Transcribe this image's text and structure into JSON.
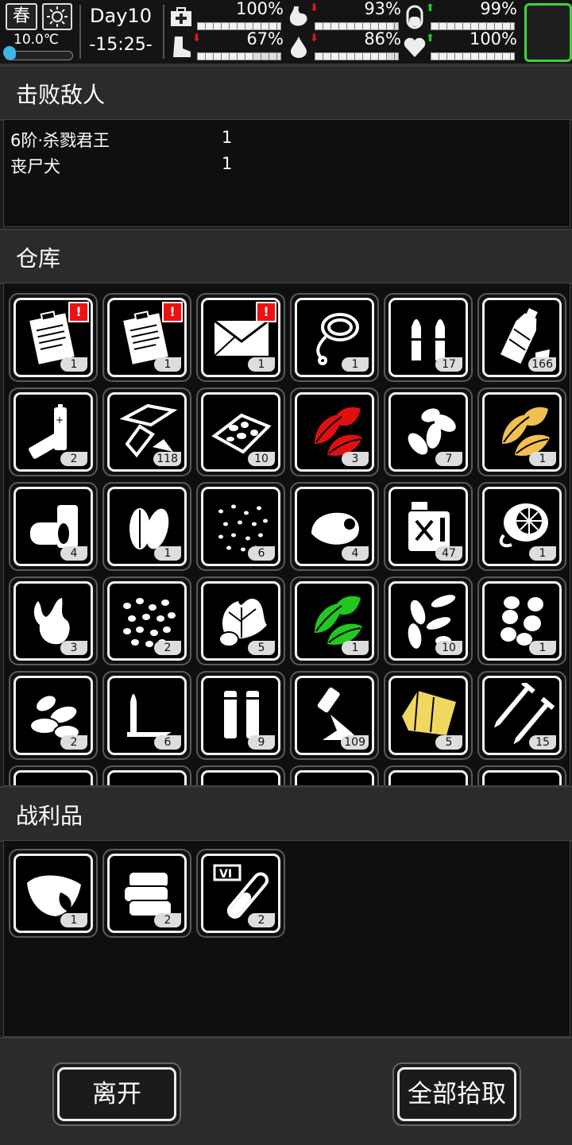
{
  "status": {
    "season": "春",
    "weather_icon": "sun-icon",
    "temperature": "10.0℃",
    "temperature_level": 0.15,
    "day": "Day10",
    "time": "-15:25-",
    "stats": [
      {
        "name": "health",
        "icon": "medkit-icon",
        "value": "100%",
        "level": 1.0,
        "trend": ""
      },
      {
        "name": "hunger",
        "icon": "stomach-icon",
        "value": "93%",
        "level": 0.93,
        "trend": "down"
      },
      {
        "name": "medicine",
        "icon": "pill-icon",
        "value": "99%",
        "level": 0.99,
        "trend": "up"
      },
      {
        "name": "stamina",
        "icon": "boot-icon",
        "value": "67%",
        "level": 0.67,
        "trend": "down"
      },
      {
        "name": "thirst",
        "icon": "water-drop-icon",
        "value": "86%",
        "level": 0.86,
        "trend": "down"
      },
      {
        "name": "mood",
        "icon": "heart-icon",
        "value": "100%",
        "level": 1.0,
        "trend": "up"
      }
    ],
    "trend_colors": {
      "down": "#e01818",
      "up": "#22cc22"
    }
  },
  "kills": {
    "title": "击败敌人",
    "rows": [
      {
        "name": "6阶·杀戮君王",
        "count": "1"
      },
      {
        "name": "丧尸犬",
        "count": "1"
      }
    ]
  },
  "warehouse": {
    "title": "仓库",
    "items": [
      {
        "icon": "clipboard-note-icon",
        "count": "1",
        "alert": true,
        "color": "#ffffff"
      },
      {
        "icon": "clipboard-note-icon",
        "count": "1",
        "alert": true,
        "color": "#ffffff"
      },
      {
        "icon": "envelope-icon",
        "count": "1",
        "alert": true,
        "color": "#ffffff"
      },
      {
        "icon": "rope-icon",
        "count": "1",
        "alert": false,
        "color": "#ffffff"
      },
      {
        "icon": "bullets-icon",
        "count": "17",
        "alert": false,
        "color": "#ffffff"
      },
      {
        "icon": "plastic-bottle-icon",
        "count": "166",
        "alert": false,
        "color": "#ffffff"
      },
      {
        "icon": "battery-icon",
        "count": "2",
        "alert": false,
        "color": "#ffffff"
      },
      {
        "icon": "glass-shards-icon",
        "count": "118",
        "alert": false,
        "color": "#ffffff"
      },
      {
        "icon": "stone-pieces-icon",
        "count": "10",
        "alert": false,
        "color": "#ffffff"
      },
      {
        "icon": "herb-leaves-icon",
        "count": "3",
        "alert": false,
        "color": "#e01010"
      },
      {
        "icon": "seed-pods-icon",
        "count": "7",
        "alert": false,
        "color": "#ffffff"
      },
      {
        "icon": "herb-leaves-icon",
        "count": "1",
        "alert": false,
        "color": "#f0c050"
      },
      {
        "icon": "cloth-roll-icon",
        "count": "4",
        "alert": false,
        "color": "#ffffff"
      },
      {
        "icon": "big-seeds-icon",
        "count": "1",
        "alert": false,
        "color": "#ffffff"
      },
      {
        "icon": "small-seeds-icon",
        "count": "6",
        "alert": false,
        "color": "#ffffff"
      },
      {
        "icon": "animal-meat-icon",
        "count": "4",
        "alert": false,
        "color": "#ffffff"
      },
      {
        "icon": "fuel-can-icon",
        "count": "47",
        "alert": false,
        "color": "#ffffff"
      },
      {
        "icon": "fan-part-icon",
        "count": "1",
        "alert": false,
        "color": "#ffffff"
      },
      {
        "icon": "ginger-root-icon",
        "count": "3",
        "alert": false,
        "color": "#ffffff"
      },
      {
        "icon": "bean-seeds-icon",
        "count": "2",
        "alert": false,
        "color": "#ffffff"
      },
      {
        "icon": "lettuce-plant-icon",
        "count": "5",
        "alert": false,
        "color": "#ffffff"
      },
      {
        "icon": "herb-leaves-icon",
        "count": "1",
        "alert": false,
        "color": "#20c820"
      },
      {
        "icon": "seed-husks-icon",
        "count": "10",
        "alert": false,
        "color": "#ffffff"
      },
      {
        "icon": "peanut-icon",
        "count": "1",
        "alert": false,
        "color": "#ffffff"
      },
      {
        "icon": "almond-icon",
        "count": "2",
        "alert": false,
        "color": "#ffffff"
      },
      {
        "icon": "rifle-rounds-icon",
        "count": "6",
        "alert": false,
        "color": "#ffffff"
      },
      {
        "icon": "shell-casings-icon",
        "count": "9",
        "alert": false,
        "color": "#ffffff"
      },
      {
        "icon": "gunpowder-icon",
        "count": "109",
        "alert": false,
        "color": "#ffffff"
      },
      {
        "icon": "yellow-cloth-icon",
        "count": "5",
        "alert": false,
        "color": "#f0d860"
      },
      {
        "icon": "screws-icon",
        "count": "15",
        "alert": false,
        "color": "#ffffff"
      }
    ]
  },
  "loot": {
    "title": "战利品",
    "items": [
      {
        "icon": "raw-meat-icon",
        "count": "1",
        "color": "#ffffff"
      },
      {
        "icon": "folded-cloth-icon",
        "count": "2",
        "color": "#ffffff"
      },
      {
        "icon": "test-tube-icon",
        "count": "2",
        "color": "#ffffff",
        "tag": "VI"
      }
    ]
  },
  "footer": {
    "leave_label": "离开",
    "take_all_label": "全部拾取"
  }
}
